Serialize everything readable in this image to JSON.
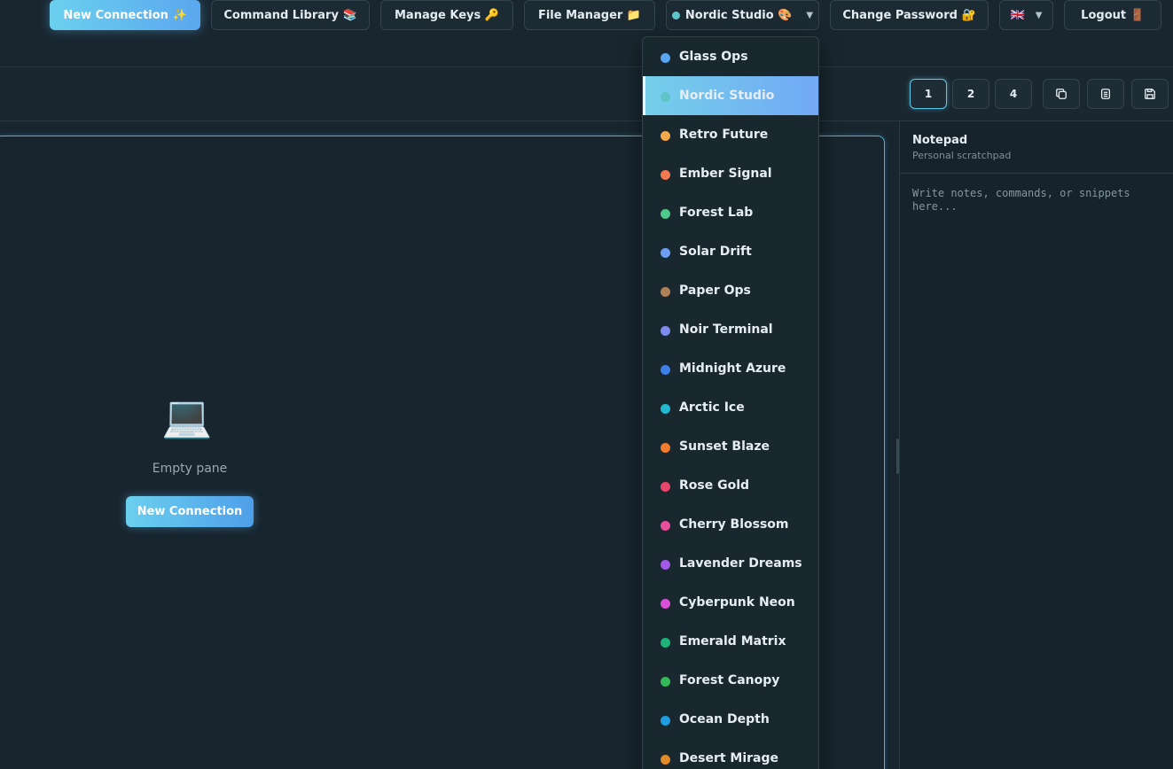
{
  "nav": {
    "new_connection": "New Connection ✨",
    "command_library": "Command Library 📚",
    "manage_keys": "Manage Keys 🔑",
    "file_manager": "File Manager 📁",
    "theme_selected": "Nordic Studio 🎨",
    "theme_selected_color": "#5fc4c8",
    "change_password": "Change Password 🔐",
    "language_flag": "🇬🇧",
    "logout": "Logout 🚪"
  },
  "toolbar": {
    "layouts": [
      "1",
      "2",
      "4"
    ],
    "active_layout": "1",
    "icons": [
      "duplicate-icon",
      "clipboard-icon",
      "save-icon"
    ]
  },
  "pane": {
    "icon": "💻",
    "empty_text": "Empty pane",
    "new_connection": "New Connection"
  },
  "notepad": {
    "title": "Notepad",
    "subtitle": "Personal scratchpad",
    "placeholder": "Write notes, commands, or snippets here..."
  },
  "themes": [
    {
      "name": "Glass Ops",
      "color": "#5aa6f0"
    },
    {
      "name": "Nordic Studio",
      "color": "#5fc4c8",
      "selected": true
    },
    {
      "name": "Retro Future",
      "color": "#f2a94b"
    },
    {
      "name": "Ember Signal",
      "color": "#f27a52"
    },
    {
      "name": "Forest Lab",
      "color": "#4fc98a"
    },
    {
      "name": "Solar Drift",
      "color": "#6b9ff2"
    },
    {
      "name": "Paper Ops",
      "color": "#b0805a"
    },
    {
      "name": "Noir Terminal",
      "color": "#7e8cf0"
    },
    {
      "name": "Midnight Azure",
      "color": "#3f7fe8"
    },
    {
      "name": "Arctic Ice",
      "color": "#22b8cf"
    },
    {
      "name": "Sunset Blaze",
      "color": "#f27c2e"
    },
    {
      "name": "Rose Gold",
      "color": "#e8456a"
    },
    {
      "name": "Cherry Blossom",
      "color": "#e6509a"
    },
    {
      "name": "Lavender Dreams",
      "color": "#a45ae8"
    },
    {
      "name": "Cyberpunk Neon",
      "color": "#d84fd8"
    },
    {
      "name": "Emerald Matrix",
      "color": "#1fb378"
    },
    {
      "name": "Forest Canopy",
      "color": "#35b85a"
    },
    {
      "name": "Ocean Depth",
      "color": "#1f9de0"
    },
    {
      "name": "Desert Mirage",
      "color": "#e08a2a"
    }
  ]
}
